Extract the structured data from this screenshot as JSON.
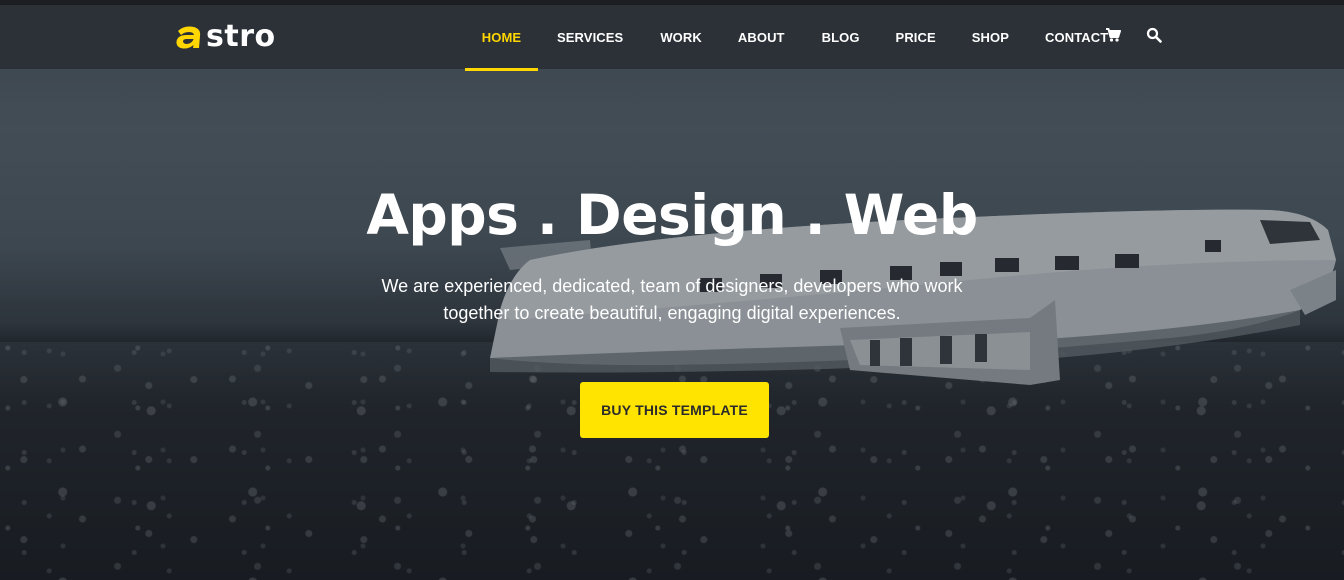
{
  "brand": {
    "logo_text": "stro",
    "logo_mark": "a-letter-mark",
    "accent_color": "#ffd600"
  },
  "nav": {
    "items": [
      {
        "label": "HOME",
        "active": true
      },
      {
        "label": "SERVICES",
        "active": false
      },
      {
        "label": "WORK",
        "active": false
      },
      {
        "label": "ABOUT",
        "active": false
      },
      {
        "label": "BLOG",
        "active": false
      },
      {
        "label": "PRICE",
        "active": false
      },
      {
        "label": "SHOP",
        "active": false
      },
      {
        "label": "CONTACT",
        "active": false
      }
    ],
    "icons": [
      "cart-icon",
      "search-icon"
    ]
  },
  "hero": {
    "title": "Apps . Design . Web",
    "subtitle_line1": "We are experienced, dedicated, team of designers, developers who work",
    "subtitle_line2": "together to create beautiful, engaging digital experiences.",
    "cta_label": "BUY THIS TEMPLATE",
    "cta_color": "#ffe400"
  }
}
